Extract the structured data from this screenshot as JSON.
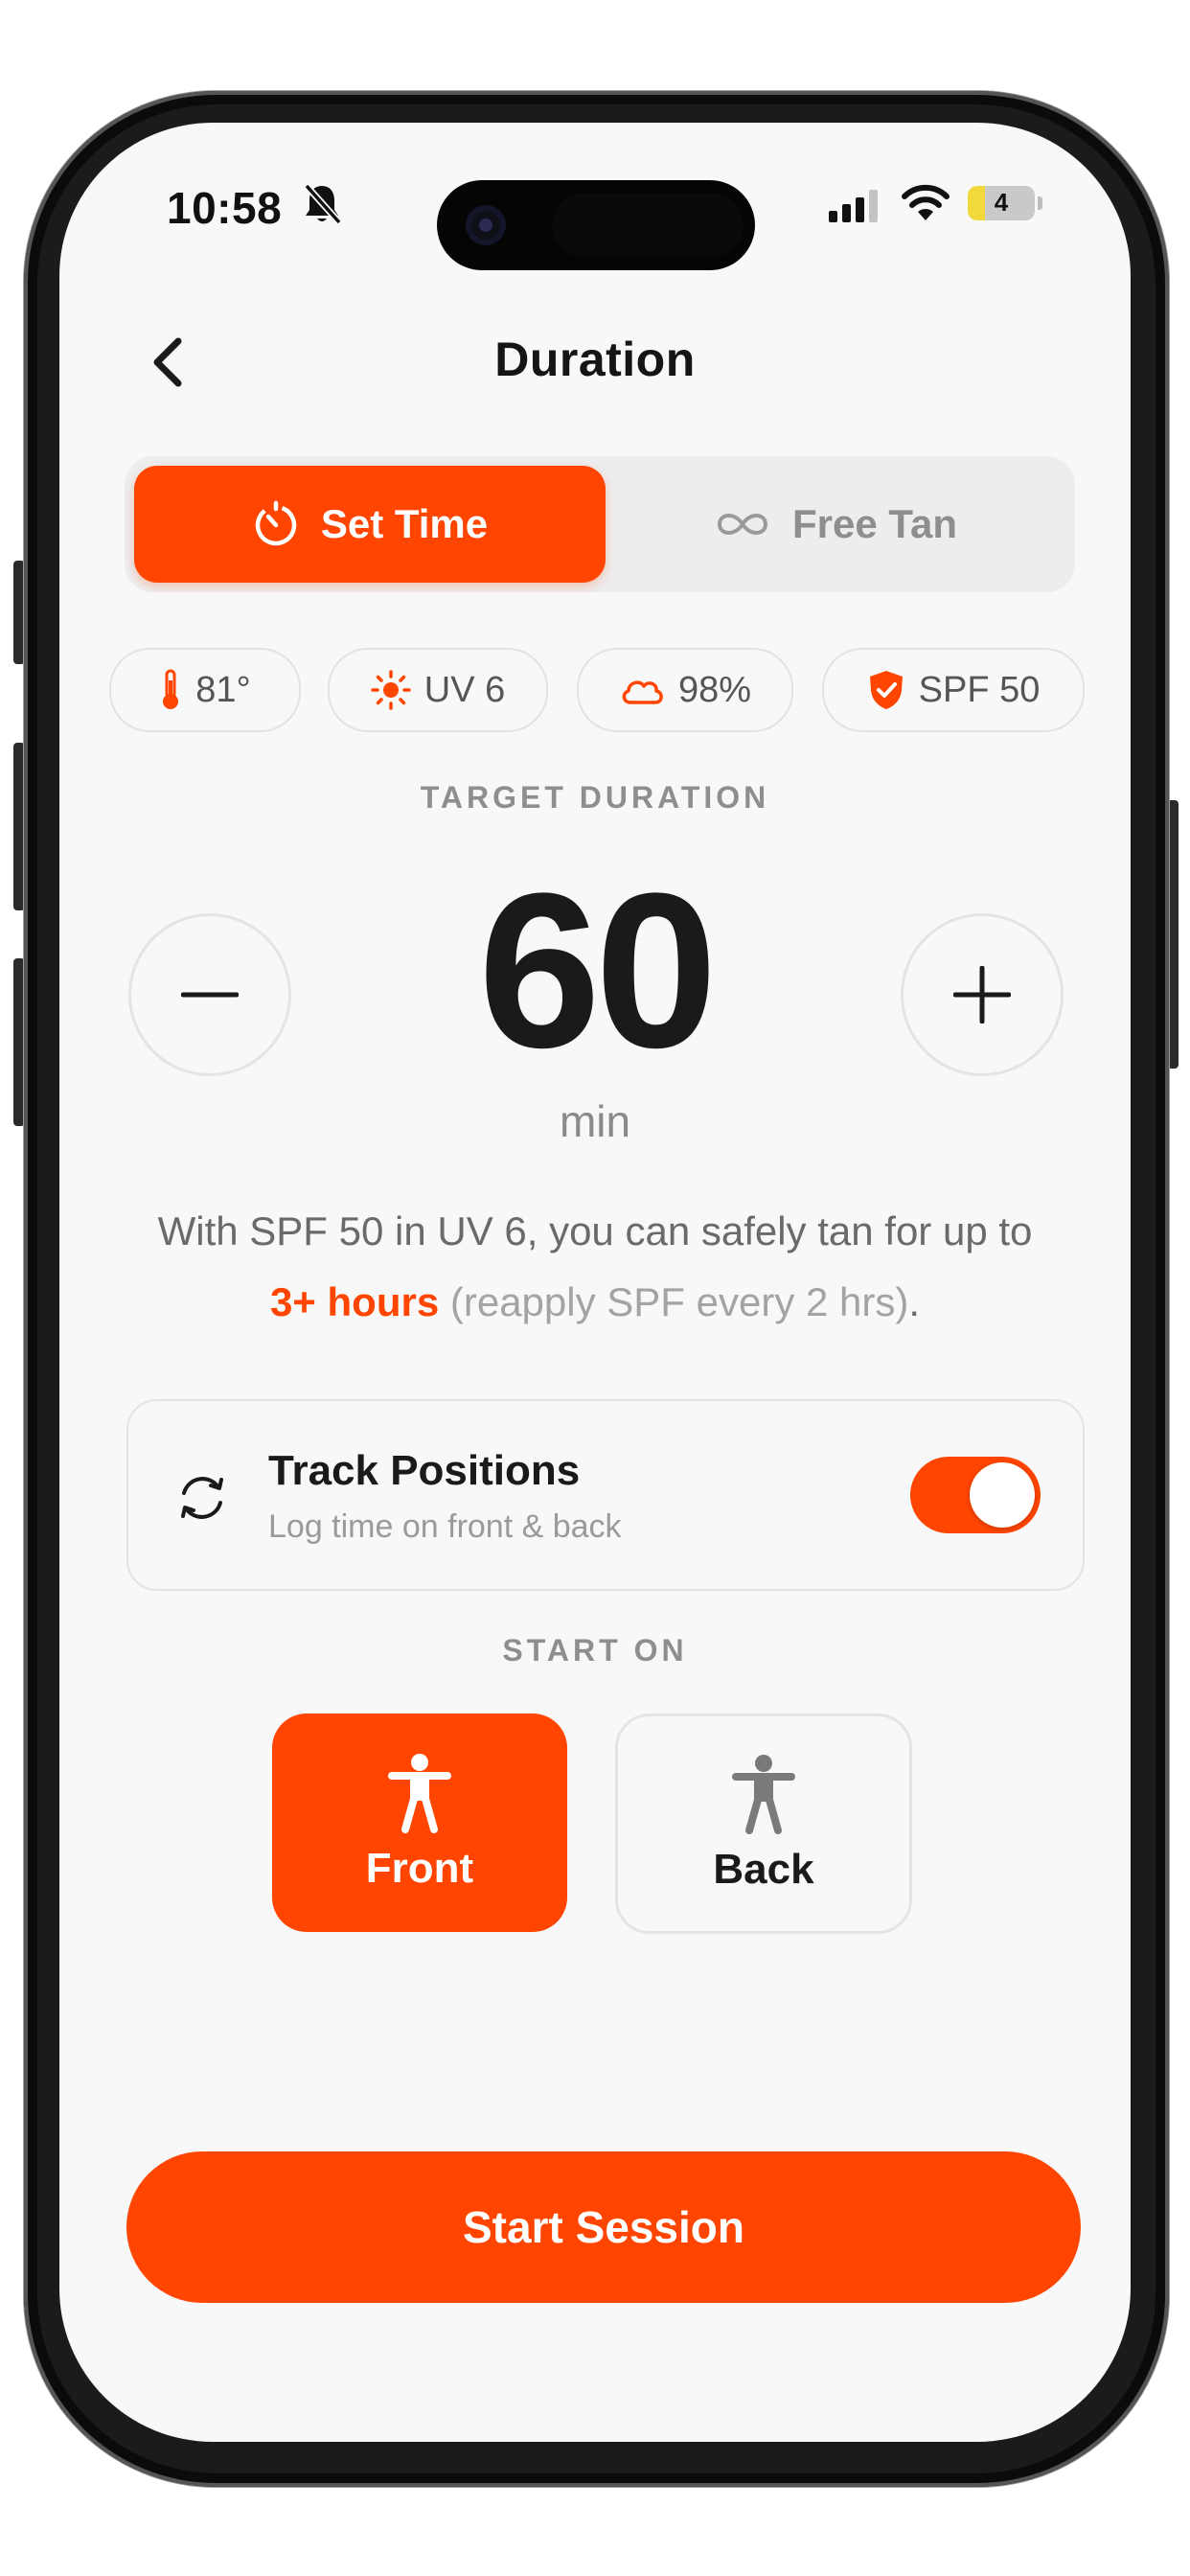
{
  "status_bar": {
    "time": "10:58",
    "battery_level": "4",
    "icons": [
      "bell-slash-icon",
      "cellular-signal-icon",
      "wifi-icon",
      "battery-icon"
    ]
  },
  "header": {
    "title": "Duration",
    "back_icon": "chevron-left-icon"
  },
  "mode_tabs": [
    {
      "label": "Set Time",
      "icon": "timer-icon",
      "selected": true
    },
    {
      "label": "Free Tan",
      "icon": "infinity-icon",
      "selected": false
    }
  ],
  "conditions": [
    {
      "icon": "thermometer-icon",
      "value": "81°"
    },
    {
      "icon": "sun-icon",
      "value": "UV 6"
    },
    {
      "icon": "cloud-icon",
      "value": "98%"
    },
    {
      "icon": "shield-icon",
      "value": "SPF 50"
    }
  ],
  "duration": {
    "section_label": "TARGET DURATION",
    "value": "60",
    "unit": "min"
  },
  "advice": {
    "before": "With SPF 50 in UV 6, you can safely tan for up to",
    "highlight": "3+ hours",
    "after": "(reapply SPF every 2 hrs)",
    "end": "."
  },
  "track_positions": {
    "title": "Track Positions",
    "subtitle": "Log time on front & back",
    "enabled": true
  },
  "start_on": {
    "section_label": "START ON",
    "options": [
      {
        "label": "Front",
        "selected": true
      },
      {
        "label": "Back",
        "selected": false
      }
    ]
  },
  "cta": {
    "label": "Start Session"
  },
  "colors": {
    "accent": "#ff4500",
    "background": "#f8f8f8"
  }
}
